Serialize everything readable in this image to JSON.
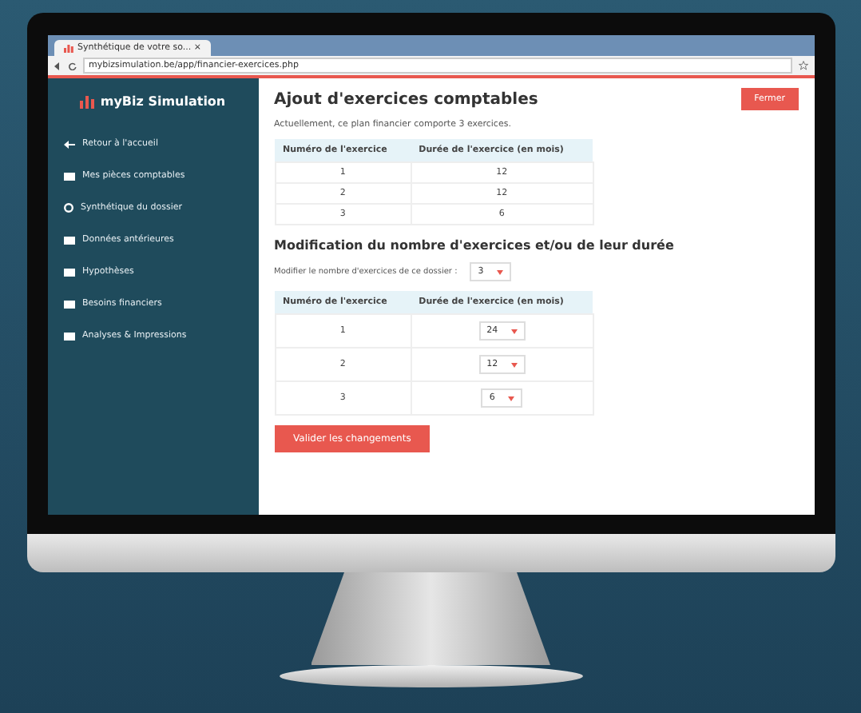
{
  "browser": {
    "tab_title": "Synthétique de votre so... ×",
    "url": "mybizsimulation.be/app/financier-exercices.php"
  },
  "sidebar": {
    "logo": "myBiz Simulation",
    "items": [
      {
        "label": "Retour à l'accueil",
        "kind": "back"
      },
      {
        "label": "Mes pièces comptables",
        "kind": "folder"
      },
      {
        "label": "Synthétique du dossier",
        "kind": "gear"
      },
      {
        "label": "Données antérieures",
        "kind": "folder"
      },
      {
        "label": "Hypothèses",
        "kind": "folder"
      },
      {
        "label": "Besoins financiers",
        "kind": "folder"
      },
      {
        "label": "Analyses & Impressions",
        "kind": "folder"
      }
    ]
  },
  "main": {
    "title": "Ajout d'exercices comptables",
    "close_button": "Fermer",
    "summary": "Actuellement, ce plan financier comporte 3 exercices.",
    "table": {
      "columns": [
        "Numéro de l'exercice",
        "Durée de l'exercice (en mois)"
      ],
      "rows": [
        [
          "1",
          "12"
        ],
        [
          "2",
          "12"
        ],
        [
          "3",
          "6"
        ]
      ]
    },
    "section_title": "Modification du nombre d'exercices et/ou de leur durée",
    "count_label": "Modifier le nombre d'exercices de ce dossier :",
    "count_value": "3",
    "edit_table": {
      "columns": [
        "Numéro de l'exercice",
        "Durée de l'exercice (en mois)"
      ],
      "rows": [
        {
          "number": "1",
          "duration": "24"
        },
        {
          "number": "2",
          "duration": "12"
        },
        {
          "number": "3",
          "duration": "6"
        }
      ]
    },
    "submit_button": "Valider les changements"
  }
}
